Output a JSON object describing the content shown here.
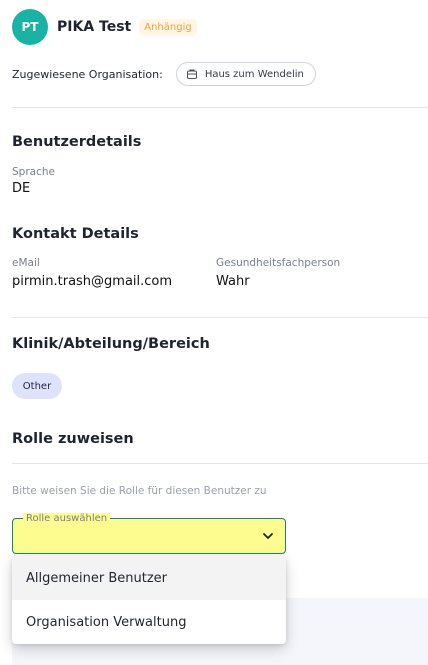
{
  "user": {
    "initials": "PT",
    "name": "PIKA Test",
    "status": "Anhängig"
  },
  "organisation": {
    "label": "Zugewiesene Organisation:",
    "chip": "Haus zum Wendelin",
    "chip_icon": "building-icon"
  },
  "benutzerdetails": {
    "title": "Benutzerdetails",
    "sprache_label": "Sprache",
    "sprache_value": "DE"
  },
  "kontakt": {
    "title": "Kontakt Details",
    "email_label": "eMail",
    "email_value": "pirmin.trash@gmail.com",
    "gesundheit_label": "Gesundheitsfachperson",
    "gesundheit_value": "Wahr"
  },
  "klinik": {
    "title": "Klinik/Abteilung/Bereich",
    "tag": "Other"
  },
  "rolle": {
    "title": "Rolle zuweisen",
    "hint": "Bitte weisen Sie die Rolle für diesen Benutzer zu",
    "select_label": "Rolle auswählen",
    "options": [
      "Allgemeiner Benutzer",
      "Organisation Verwaltung"
    ]
  },
  "colors": {
    "avatar": "#19b3a6",
    "status_text": "#f3a13c",
    "status_bg": "#fff6e5",
    "select_bg": "#fdfc8f",
    "select_border": "#1e7f7a",
    "tag_bg": "#dde3ff"
  }
}
